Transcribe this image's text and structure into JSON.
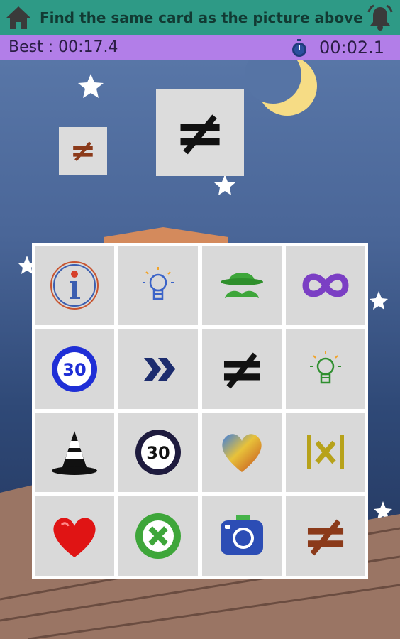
{
  "header": {
    "title": "Find the same card as the picture above",
    "home_icon": "home-icon",
    "alarm_icon": "alarm-bell-icon"
  },
  "stats": {
    "best": "Best : 00:17.4",
    "timer": "00:02.1",
    "timer_icon": "stopwatch-icon"
  },
  "target": {
    "symbol": "≠",
    "color": "#111111",
    "hint_symbol": "≠",
    "hint_color": "#8b3a1a"
  },
  "grid": {
    "cards": [
      {
        "icon": "info-icon"
      },
      {
        "icon": "lightbulb-icon",
        "color": "#3a63c8"
      },
      {
        "icon": "bowler-hat-mustache-icon"
      },
      {
        "icon": "infinity-icon",
        "color": "#7b3fc4"
      },
      {
        "icon": "speed-limit-30-blue-icon",
        "text": "30"
      },
      {
        "icon": "double-chevron-right-icon",
        "color": "#1c2c6e"
      },
      {
        "icon": "not-equal-icon",
        "text": "≠",
        "color": "#111111"
      },
      {
        "icon": "lightbulb-icon",
        "color": "#2f8f2f"
      },
      {
        "icon": "traffic-cone-icon"
      },
      {
        "icon": "speed-limit-30-icon",
        "text": "30"
      },
      {
        "icon": "rainbow-heart-icon"
      },
      {
        "icon": "absolute-value-icon",
        "text": "|x|",
        "color": "#b7a21a"
      },
      {
        "icon": "red-heart-icon"
      },
      {
        "icon": "green-x-circle-icon"
      },
      {
        "icon": "camera-icon"
      },
      {
        "icon": "not-equal-icon",
        "text": "≠",
        "color": "#8b3a1a"
      }
    ]
  }
}
